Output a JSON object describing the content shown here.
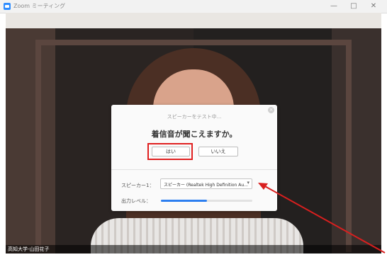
{
  "window": {
    "title": "Zoom ミーティング",
    "minimize": "—",
    "maximize": "□",
    "close": "✕"
  },
  "video": {
    "participant_name": "高知大学-山田花子"
  },
  "dialog": {
    "status_text": "スピーカーをテスト中...",
    "question": "着信音が聞こえますか。",
    "yes_label": "はい",
    "no_label": "いいえ",
    "close_glyph": "×",
    "speaker_label": "スピーカー1：",
    "speaker_value": "スピーカー (Realtek High Definition Au...",
    "output_level_label": "出力レベル：",
    "output_level": 0.5
  },
  "colors": {
    "accent": "#2d7ff0",
    "highlight": "#e02020",
    "annotation_arrow": "#d91f1f"
  },
  "icons": {
    "app": "zoom-app-icon",
    "dropdown": "chevron-down-icon"
  }
}
